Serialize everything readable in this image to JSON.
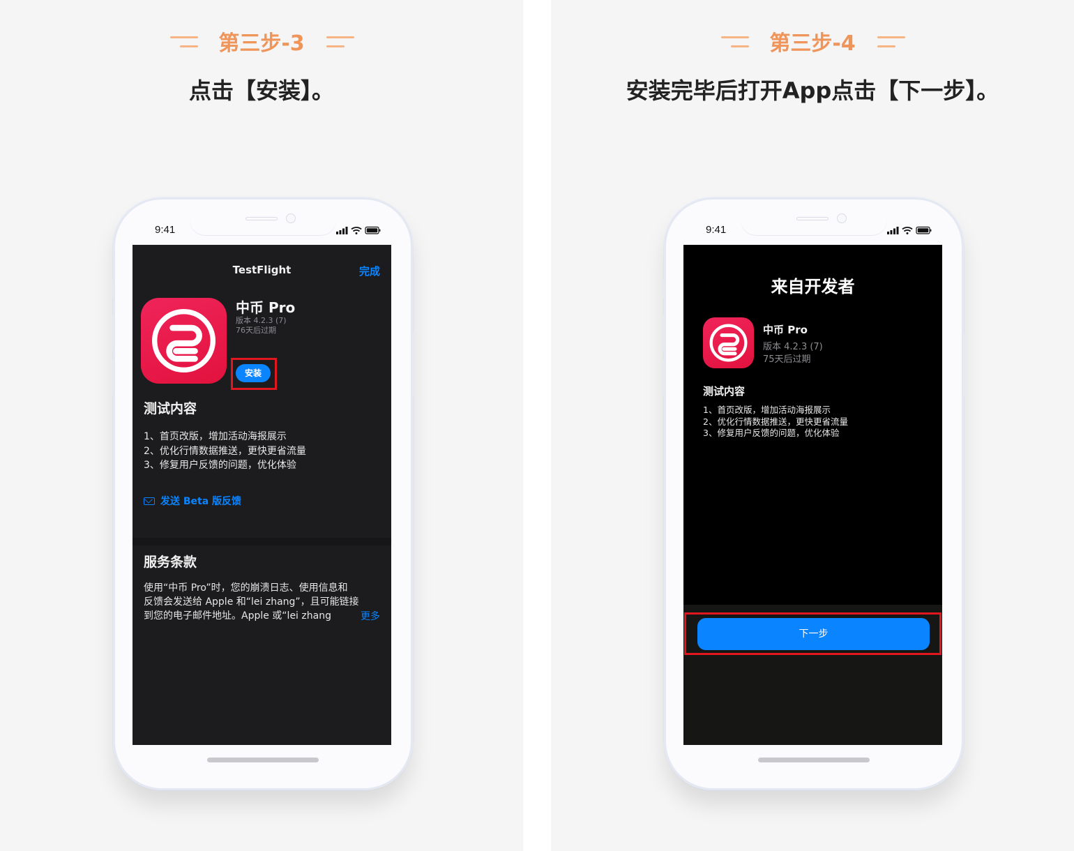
{
  "left": {
    "step_title": "第三步-3",
    "step_desc": "点击【安装】。",
    "status_time": "9:41",
    "nav_title": "TestFlight",
    "done_label": "完成",
    "app_name": "中币 Pro",
    "version": "版本 4.2.3 (7)",
    "expiry": "76天后过期",
    "install_label": "安装",
    "test_content_title": "测试内容",
    "notes": [
      "1、首页改版，增加活动海报展示",
      "2、优化行情数据推送，更快更省流量",
      "3、修复用户反馈的问题，优化体验"
    ],
    "feedback_label": "发送 Beta 版反馈",
    "terms_title": "服务条款",
    "terms_lines": [
      "使用“中币 Pro”时，您的崩溃日志、使用信息和",
      "反馈会发送给 Apple 和“lei zhang”，且可能链接",
      "到您的电子邮件地址。Apple 或“lei zhang"
    ],
    "more_label": "更多"
  },
  "right": {
    "step_title": "第三步-4",
    "step_desc": "安装完毕后打开App点击【下一步】。",
    "status_time": "9:41",
    "sheet_title": "来自开发者",
    "app_name": "中币 Pro",
    "version": "版本 4.2.3 (7)",
    "expiry": "75天后过期",
    "test_content_title": "测试内容",
    "notes": [
      "1、首页改版，增加活动海报展示",
      "2、优化行情数据推送，更快更省流量",
      "3、修复用户反馈的问题，优化体验"
    ],
    "next_label": "下一步"
  },
  "colors": {
    "accent_orange": "#f0955a",
    "ios_blue": "#0a84ff",
    "highlight_red": "#e0171f",
    "app_icon_red": "#e8163f"
  },
  "icons": [
    "signal-icon",
    "wifi-icon",
    "battery-icon",
    "mail-icon",
    "app-logo-icon"
  ]
}
